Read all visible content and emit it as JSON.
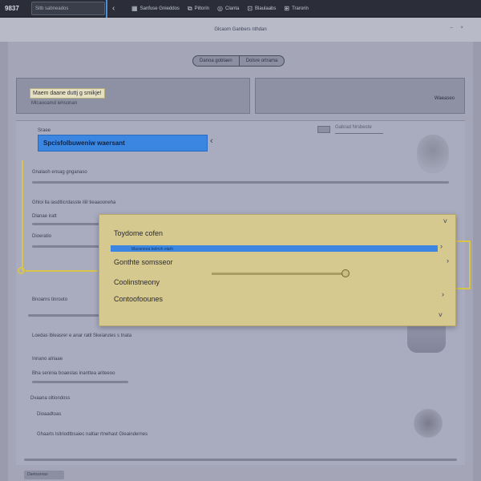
{
  "topbar": {
    "logo": "9837",
    "search_text": "Sitb sabneados",
    "back_glyph": "‹",
    "items": [
      {
        "icon": "▦",
        "label": "Sanfuse Gnieddos"
      },
      {
        "icon": "⧉",
        "label": "Piltorin"
      },
      {
        "icon": "◎",
        "label": "Clanta"
      },
      {
        "icon": "⊡",
        "label": "Blaulaabs"
      },
      {
        "icon": "⊞",
        "label": "Trarorin"
      }
    ]
  },
  "subbar": {
    "title": "Glcaom Ganbers nthdan",
    "controls": "– ×"
  },
  "pills": [
    "Danoa goblaen",
    "Dolsre ortrama"
  ],
  "card_a": {
    "label": "Maem daane duttj g smikje!",
    "sub": "Mlcaooamd iehsonan"
  },
  "card_b": {
    "label": "Waeaseo"
  },
  "form": {
    "field_label": "Sraee",
    "field_value": "Spcisfolbuweniw waersant",
    "select_text": "Gabrad Nrsbeste",
    "rows": [
      "Gnalaoh ensag gnganaso",
      "Ghloi lla iasdtlicrdasste iliil tieaaooneha",
      "Dlanae iratt",
      "Dioeratio",
      "Bnoarns tinrouto",
      "Shafaboamrsoa",
      "Loedas lbleasrer e anar ratil Skeiarutes s tnata",
      "Innano alriaae",
      "Bha seninia boaeslas inanttea ariteeoo",
      "Dvaana oltiondoss",
      "Dioaadtoas",
      "Ghaarts lsitriodtbsaiec naltiar rtnehast Gleaindernes"
    ]
  },
  "dropdown": {
    "items": [
      "Toydome cofen",
      "Gonthte somsseor",
      "Coolinstneony",
      "Contoofoounes"
    ],
    "selected_text": "Maosneoa bolnvh elarh"
  },
  "footer": {
    "label": "Daetsanras"
  }
}
